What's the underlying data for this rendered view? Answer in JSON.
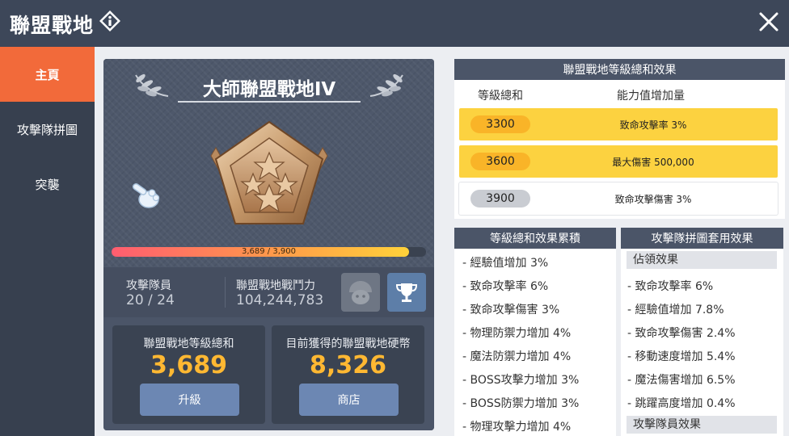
{
  "header": {
    "title": "聯盟戰地"
  },
  "sidebar": {
    "items": [
      {
        "label": "主頁"
      },
      {
        "label": "攻擊隊拼圖"
      },
      {
        "label": "突襲"
      }
    ]
  },
  "rank": {
    "title": "大師聯盟戰地IV",
    "progress_text": "3,689 / 3,900",
    "progress_fraction": 0.946
  },
  "stats": {
    "members_label": "攻擊隊員",
    "members_value": "20 / 24",
    "power_label": "聯盟戰地戰鬥力",
    "power_value": "104,244,783"
  },
  "level_total": {
    "label": "聯盟戰地等級總和",
    "value": "3,689",
    "button": "升級"
  },
  "coins": {
    "label": "目前獲得的聯盟戰地硬幣",
    "value": "8,326",
    "button": "商店"
  },
  "effects_table": {
    "title": "聯盟戰地等級總和效果",
    "col1": "等級總和",
    "col2": "能力值增加量",
    "rows": [
      {
        "level": "3300",
        "effect": "致命攻擊率 3%"
      },
      {
        "level": "3600",
        "effect": "最大傷害 500,000"
      },
      {
        "level": "3900",
        "effect": "致命攻擊傷害 3%"
      }
    ]
  },
  "cumulative": {
    "title": "等級總和效果累積",
    "items": [
      "- 經驗值增加 3%",
      "- 致命攻擊率 6%",
      "- 致命攻擊傷害 3%",
      "- 物理防禦力增加 4%",
      "- 魔法防禦力增加 4%",
      "- BOSS攻擊力增加 3%",
      "- BOSS防禦力增加 3%",
      "- 物理攻擊力增加 4%"
    ]
  },
  "puzzle": {
    "title": "攻擊隊拼圖套用效果",
    "group1": "佔領效果",
    "items": [
      "- 致命攻擊率 6%",
      "- 經驗值增加 7.8%",
      "- 致命攻擊傷害 2.4%",
      "- 移動速度增加 5.4%",
      "- 魔法傷害增加 6.5%",
      "- 跳躍高度增加 0.4%"
    ],
    "group2": "攻擊隊員效果"
  },
  "colors": {
    "accent": "#f26a3a",
    "gold": "#fcd240",
    "value_gold": "#ffb832",
    "button_blue": "#6c87b3"
  }
}
